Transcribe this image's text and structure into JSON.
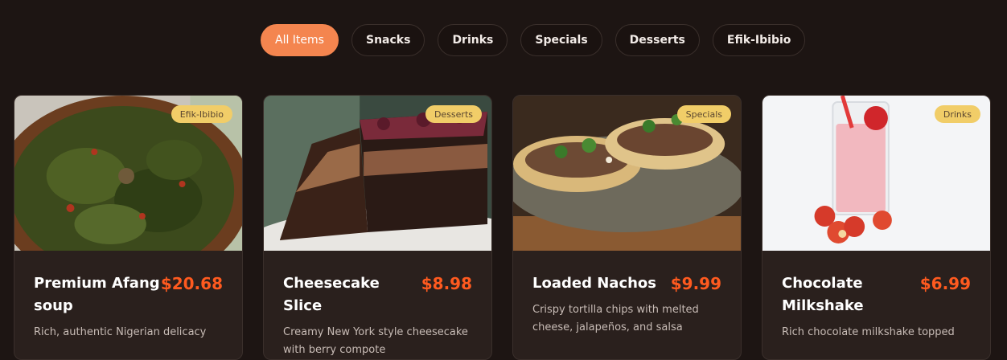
{
  "filters": [
    {
      "label": "All Items",
      "active": true
    },
    {
      "label": "Snacks",
      "active": false
    },
    {
      "label": "Drinks",
      "active": false
    },
    {
      "label": "Specials",
      "active": false
    },
    {
      "label": "Desserts",
      "active": false
    },
    {
      "label": "Efik-Ibibio",
      "active": false
    }
  ],
  "items": [
    {
      "name": "Premium Afang soup",
      "price": "$20.68",
      "category": "Efik-Ibibio",
      "description": "Rich, authentic Nigerian delicacy"
    },
    {
      "name": "Cheesecake Slice",
      "price": "$8.98",
      "category": "Desserts",
      "description": "Creamy New York style cheesecake with berry compote"
    },
    {
      "name": "Loaded Nachos",
      "price": "$9.99",
      "category": "Specials",
      "description": "Crispy tortilla chips with melted cheese, jalapeños, and salsa"
    },
    {
      "name": "Chocolate Milkshake",
      "price": "$6.99",
      "category": "Drinks",
      "description": "Rich chocolate milkshake topped"
    }
  ],
  "colors": {
    "background": "#1d1513",
    "accent": "#f4854f",
    "price": "#ff5a1f",
    "badge": "#f1cd68"
  }
}
